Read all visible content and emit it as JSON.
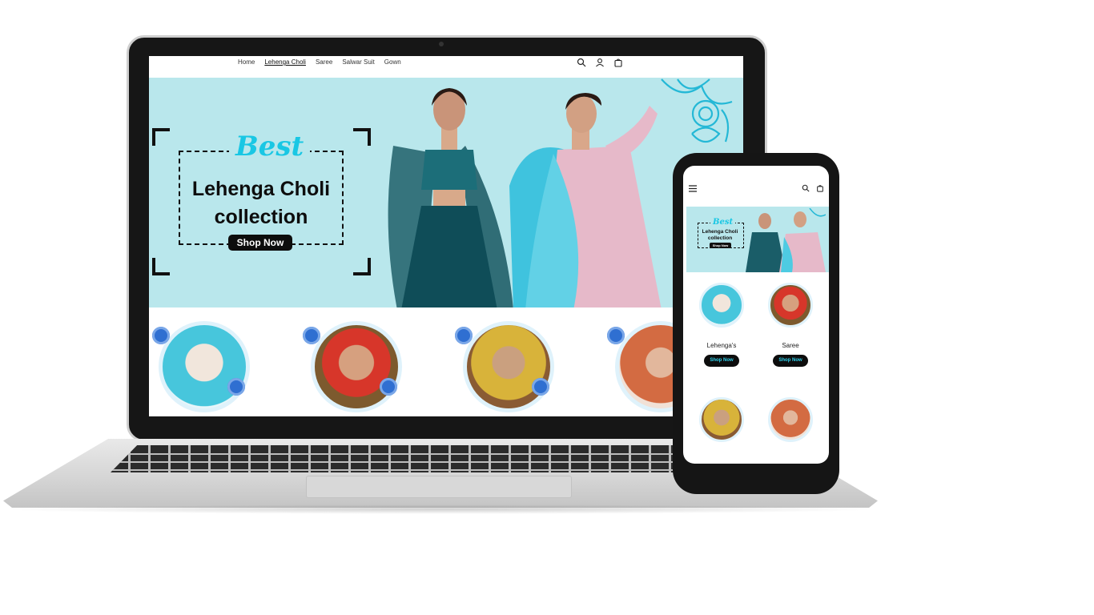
{
  "laptop": {
    "nav": {
      "items": [
        "Home",
        "Lehenga Choli",
        "Saree",
        "Salwar Suit",
        "Gown"
      ],
      "active_index": 1
    },
    "header_icons": [
      "search-icon",
      "account-icon",
      "cart-icon"
    ],
    "hero": {
      "badge": "Best",
      "title_line1": "Lehenga Choli",
      "title_line2": "collection",
      "button": "Shop Now"
    },
    "categories": [
      "lehenga",
      "saree",
      "salwar-suit",
      "gown"
    ]
  },
  "phone": {
    "header_icons": [
      "menu-icon",
      "search-icon",
      "cart-icon"
    ],
    "hero": {
      "badge": "Best",
      "title_line1": "Lehenga Choli",
      "title_line2": "collection",
      "button": "Shop Now"
    },
    "categories": [
      {
        "label": "Lehenga's",
        "button": "Shop Now"
      },
      {
        "label": "Saree",
        "button": "Shop Now"
      }
    ]
  },
  "colors": {
    "hero_bg": "#b9e7ec",
    "accent_cyan": "#19c7e4",
    "button_bg": "#0d0d0d"
  }
}
